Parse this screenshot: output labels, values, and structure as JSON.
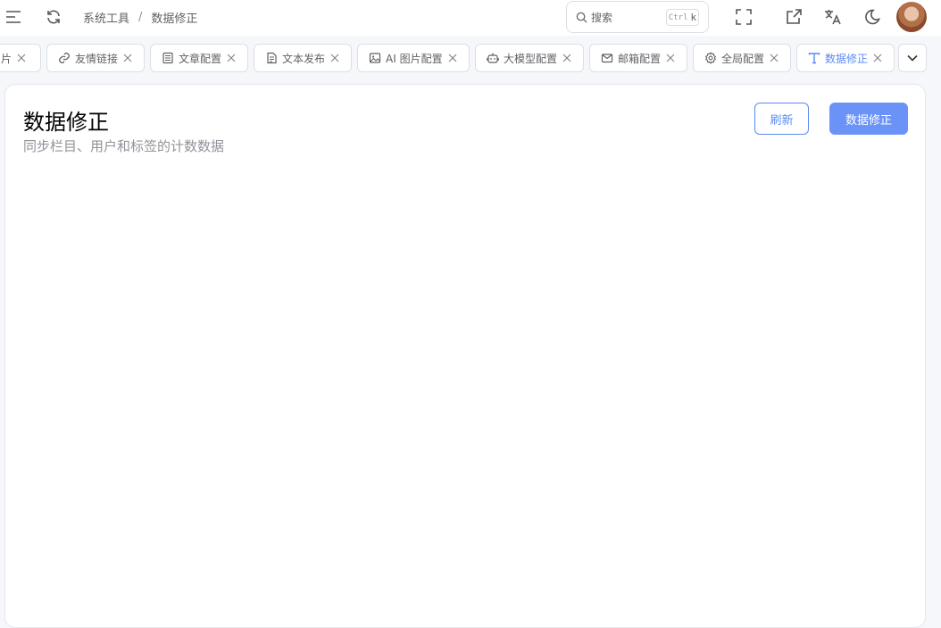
{
  "header": {
    "breadcrumb": {
      "parent": "系统工具",
      "separator": "/",
      "current": "数据修正"
    },
    "search": {
      "label": "搜索",
      "kbd_ctrl": "Ctrl",
      "kbd_key": "k"
    }
  },
  "tabs": {
    "items": [
      {
        "label": "片",
        "icon": "image-icon"
      },
      {
        "label": "友情链接",
        "icon": "link-icon"
      },
      {
        "label": "文章配置",
        "icon": "article-icon"
      },
      {
        "label": "文本发布",
        "icon": "document-icon"
      },
      {
        "label": "AI 图片配置",
        "icon": "image-icon"
      },
      {
        "label": "大模型配置",
        "icon": "robot-icon"
      },
      {
        "label": "邮箱配置",
        "icon": "mail-icon"
      },
      {
        "label": "全局配置",
        "icon": "gear-icon"
      },
      {
        "label": "数据修正",
        "icon": "text-type-icon",
        "active": true
      }
    ]
  },
  "main": {
    "title": "数据修正",
    "subtitle": "同步栏目、用户和标签的计数数据",
    "refresh_label": "刷新",
    "fix_label": "数据修正"
  },
  "colors": {
    "accent": "#5a8af5",
    "primary_button": "#6b93f7",
    "border": "#dcdfe6"
  }
}
